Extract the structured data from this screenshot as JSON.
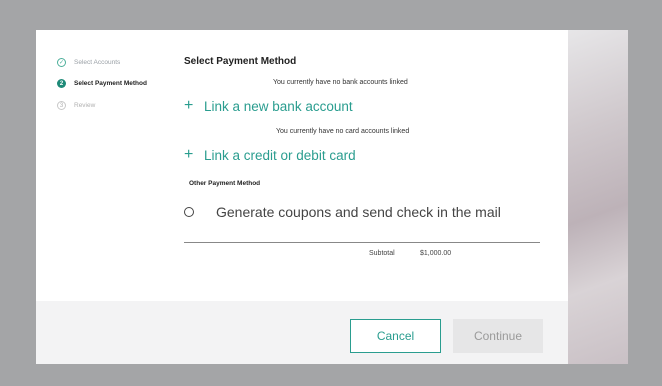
{
  "steps": [
    {
      "label": "Select Accounts",
      "state": "done",
      "icon": "check-icon",
      "glyph": "✓"
    },
    {
      "label": "Select Payment Method",
      "state": "active",
      "icon": "step-number-icon",
      "glyph": "2"
    },
    {
      "label": "Review",
      "state": "pending",
      "icon": "step-number-icon",
      "glyph": "3"
    }
  ],
  "main": {
    "title": "Select Payment Method",
    "no_bank_note": "You currently have no bank accounts linked",
    "link_bank_label": "Link a new bank account",
    "no_card_note": "You currently have no card accounts linked",
    "link_card_label": "Link a credit or debit card",
    "other_heading": "Other Payment Method",
    "coupon_option_label": "Generate coupons and send check in the mail",
    "subtotal_label": "Subtotal",
    "subtotal_value": "$1,000.00"
  },
  "footer": {
    "cancel_label": "Cancel",
    "continue_label": "Continue"
  },
  "colors": {
    "accent": "#2a9d8f",
    "overlay": "#a4a5a7"
  }
}
